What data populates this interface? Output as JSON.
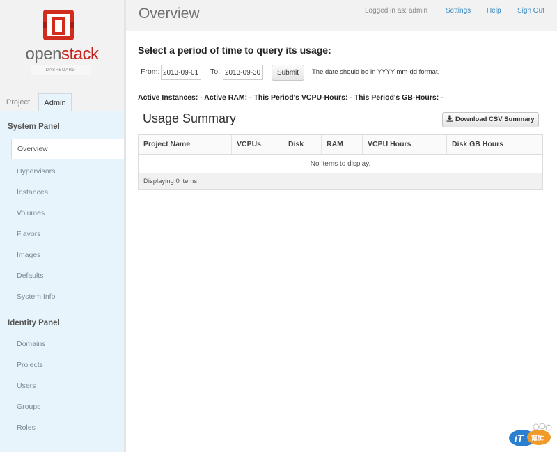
{
  "brand": {
    "name_open": "open",
    "name_stack": "stack",
    "subtitle": "DASHBOARD"
  },
  "header": {
    "title": "Overview",
    "logged_in": "Logged in as: admin",
    "links": {
      "settings": "Settings",
      "help": "Help",
      "sign_out": "Sign Out"
    }
  },
  "tabs": {
    "project": "Project",
    "admin": "Admin"
  },
  "sidebar": {
    "system_panel": {
      "title": "System Panel",
      "items": [
        "Overview",
        "Hypervisors",
        "Instances",
        "Volumes",
        "Flavors",
        "Images",
        "Defaults",
        "System Info"
      ]
    },
    "identity_panel": {
      "title": "Identity Panel",
      "items": [
        "Domains",
        "Projects",
        "Users",
        "Groups",
        "Roles"
      ]
    }
  },
  "query": {
    "heading": "Select a period of time to query its usage:",
    "from_label": "From:",
    "from_value": "2013-09-01",
    "to_label": "To:",
    "to_value": "2013-09-30",
    "submit": "Submit",
    "hint": "The date should be in YYYY-mm-dd format."
  },
  "stats_line": "Active Instances: - Active RAM: - This Period's VCPU-Hours: - This Period's GB-Hours: -",
  "usage": {
    "title": "Usage Summary",
    "download_button": "Download CSV Summary",
    "columns": [
      "Project Name",
      "VCPUs",
      "Disk",
      "RAM",
      "VCPU Hours",
      "Disk GB Hours"
    ],
    "empty_message": "No items to display.",
    "footer": "Displaying 0 items"
  },
  "watermark": {
    "text_it": "iT",
    "text_cn": "幫忙"
  },
  "colors": {
    "brand_red": "#c8201a",
    "link_blue": "#3a8bc3",
    "nav_bg": "#e7f4fb"
  },
  "icons": {
    "logo": "openstack-logo-icon",
    "download": "download-icon"
  }
}
